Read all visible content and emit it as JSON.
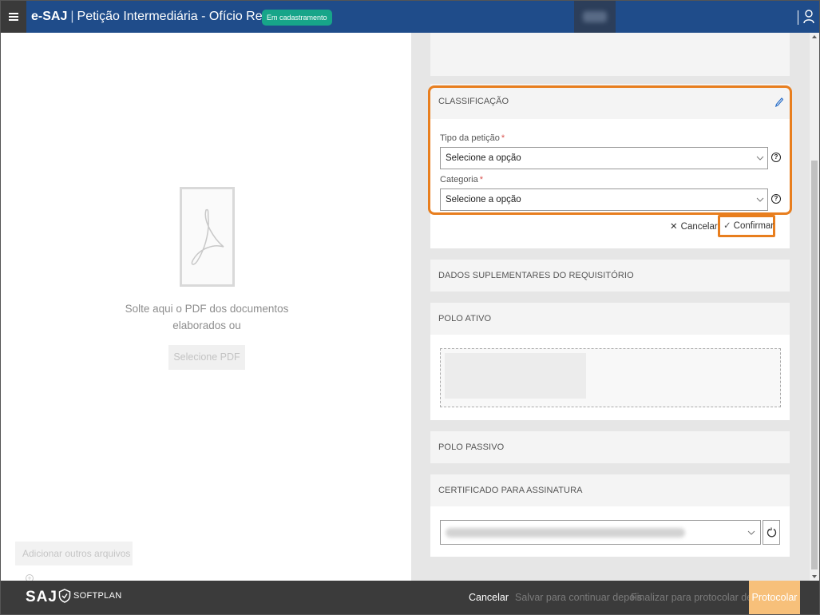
{
  "header": {
    "app_name": "e-SAJ",
    "separator": "|",
    "page_title": "Petição Intermediária - Ofício Requisitório",
    "status_badge": "Em cadastramento"
  },
  "left": {
    "drop_text": "Solte aqui o PDF dos documentos elaborados ou",
    "select_pdf": "Selecione PDF",
    "add_files": "Adicionar outros arquivos"
  },
  "classification": {
    "title": "CLASSIFICAÇÃO",
    "tipo_label": "Tipo da petição",
    "tipo_value": "Selecione a opção",
    "categoria_label": "Categoria",
    "categoria_value": "Selecione a opção",
    "required_mark": "*",
    "help": "?",
    "cancel": "Cancelar",
    "confirm": "Confirmar"
  },
  "sections": {
    "dados": "DADOS SUPLEMENTARES DO REQUISITÓRIO",
    "polo_ativo": "POLO ATIVO",
    "polo_passivo": "POLO PASSIVO",
    "certificado": "CERTIFICADO PARA ASSINATURA"
  },
  "footer": {
    "logo_saj": "SAJ",
    "logo_softplan": "SOFTPLAN",
    "cancel": "Cancelar",
    "save": "Salvar para continuar depois",
    "finalize": "Finalizar para protocolar depois",
    "protocolar": "Protocolar"
  },
  "colors": {
    "header_bg": "#1f4c8a",
    "badge_bg": "#17a589",
    "highlight": "#e87e1e",
    "footer_bg": "#3b3b3b",
    "protocolar_bg": "#f7c07a"
  }
}
